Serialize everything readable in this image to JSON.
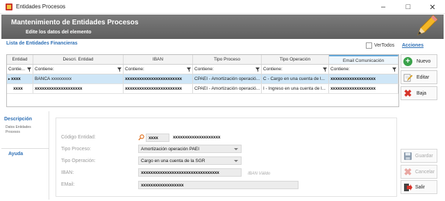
{
  "window": {
    "title": "Entidades Procesos"
  },
  "banner": {
    "title": "Mantenimiento de Entidades Procesos",
    "subtitle": "Edite los datos del elemento"
  },
  "list": {
    "title": "Lista de Entidades Financieras",
    "ver_todos_label": "VerTodos",
    "acciones_label": "Acciones"
  },
  "grid": {
    "columns": [
      "Entidad",
      "Descri. Entidad",
      "IBAN",
      "Tipo Proceso",
      "Tipo Operación",
      "Email Comunicación"
    ],
    "filters": [
      "Contie...",
      "Contiene:",
      "Contiene:",
      "Contiene:",
      "Contiene:",
      "Contiene:"
    ],
    "rows": [
      [
        "xxxx",
        "BANCA xxxxxxxxx",
        "xxxxxxxxxxxxxxxxxxxxxxxx",
        "CPAEI - Amortización operació...",
        "C - Cargo en una cuenta de l...",
        "xxxxxxxxxxxxxxxxxxx"
      ],
      [
        "xxxx",
        "xxxxxxxxxxxxxxxxxxxx",
        "xxxxxxxxxxxxxxxxxxxxxxxx",
        "CPAEI - Amortización operació...",
        "I - Ingreso en una cuenta de l...",
        "xxxxxxxxxxxxxxxxxxx"
      ]
    ]
  },
  "actions": {
    "nuevo": "Nuevo",
    "editar": "Editar",
    "baja": "Baja"
  },
  "tabs": {
    "descripcion": "Descripción",
    "descripcion_sub": "Datos Entidades Procesos",
    "ayuda": "Ayuda"
  },
  "form": {
    "codigo_label": "Código Entidad:",
    "codigo_value": "xxxx",
    "entidad_name": "xxxxxxxxxxxxxxxxxxxx",
    "tipo_proceso_label": "Tipo Proceso:",
    "tipo_proceso_value": "Amortización operación PAEI",
    "tipo_operacion_label": "Tipo Operación:",
    "tipo_operacion_value": "Cargo en una cuenta de la SGR",
    "iban_label": "IBAN:",
    "iban_value": "xxxxxxxxxxxxxxxxxxxxxxxxxxxxxxxxx",
    "iban_hint": "IBAN Válido",
    "email_label": "EMail:",
    "email_value": "xxxxxxxxxxxxxxxxxx"
  },
  "buttons": {
    "guardar": "Guardar",
    "cancelar": "Cancelar",
    "salir": "Salir"
  },
  "colors": {
    "accent": "#2d6fb5",
    "banner": "#6e6e6e",
    "selected_row": "#cfe6f7",
    "nuevo": "#3aa24a",
    "baja": "#d6342a"
  }
}
